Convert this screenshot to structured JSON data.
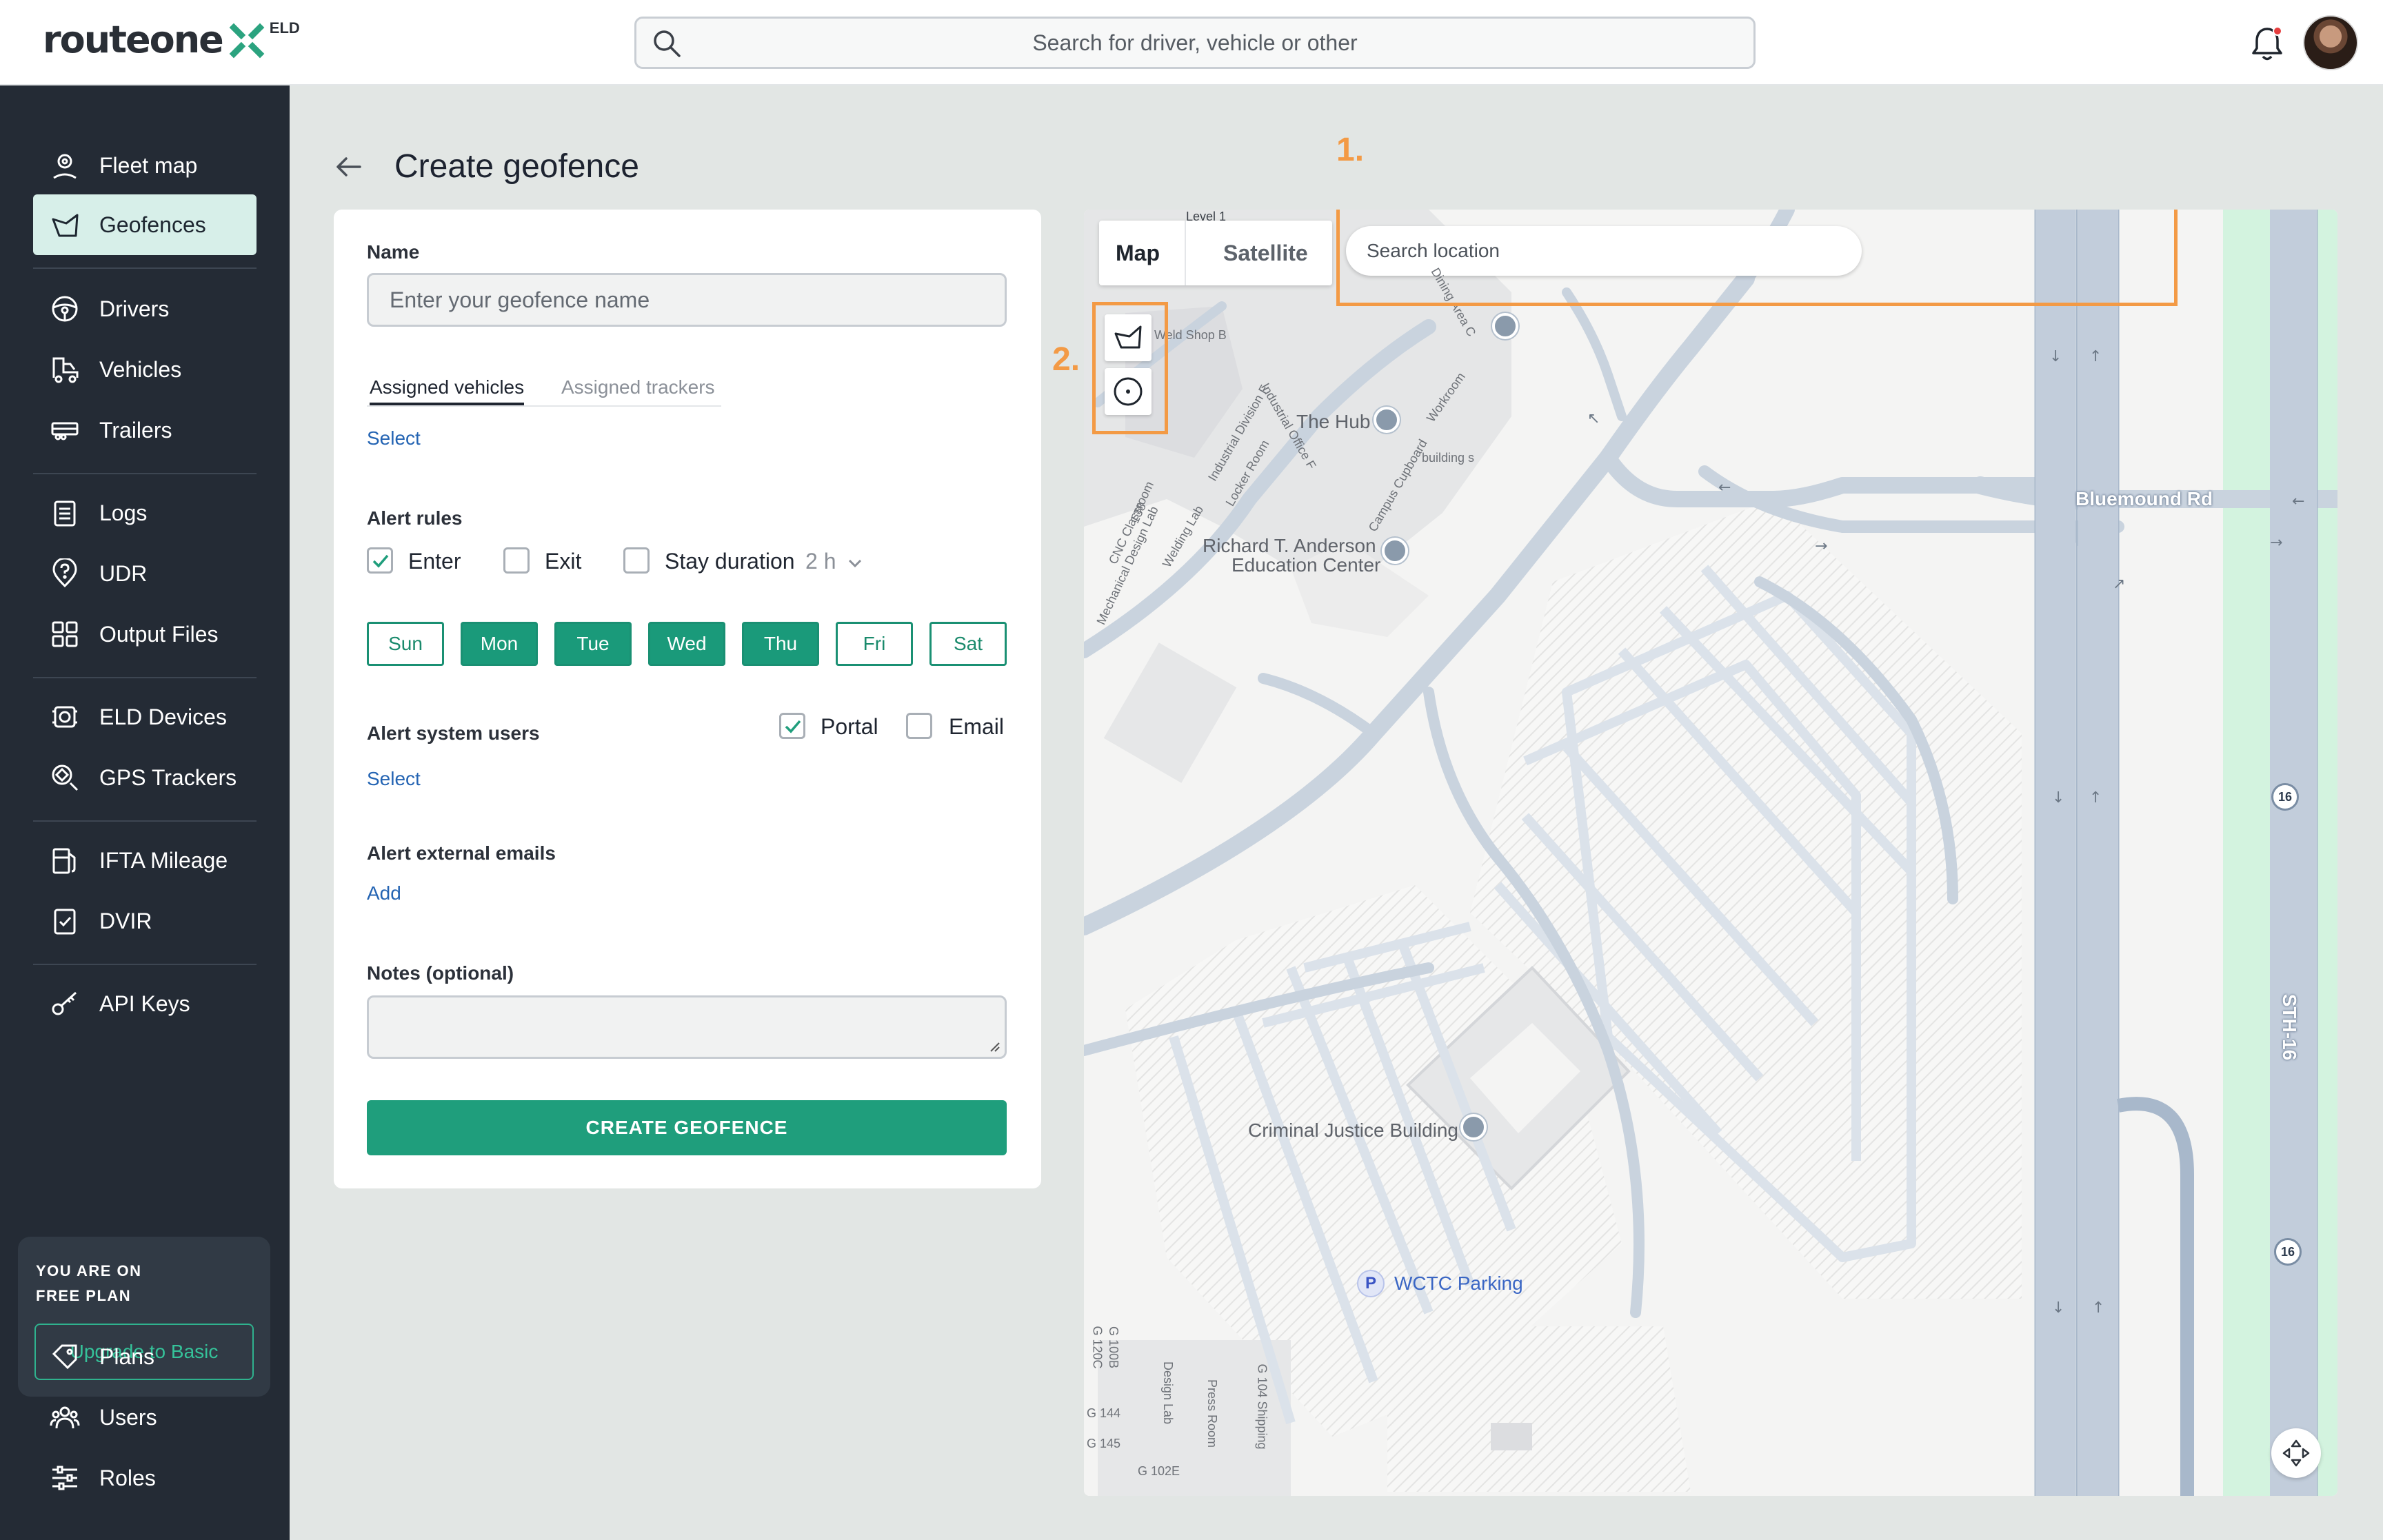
{
  "brand": {
    "name": "routeone",
    "suffix": "ELD",
    "accent": "#1f9e7c"
  },
  "topbar": {
    "search_placeholder": "Search for driver, vehicle or other",
    "icons": [
      "search-icon",
      "bell-icon",
      "avatar"
    ]
  },
  "sidebar": {
    "items": [
      {
        "label": "Fleet map",
        "icon": "map-pin-icon",
        "active": false
      },
      {
        "label": "Geofences",
        "icon": "geofence-icon",
        "active": true
      },
      {
        "label": "Drivers",
        "icon": "steering-wheel-icon",
        "active": false
      },
      {
        "label": "Vehicles",
        "icon": "truck-icon",
        "active": false
      },
      {
        "label": "Trailers",
        "icon": "trailer-icon",
        "active": false
      },
      {
        "label": "Logs",
        "icon": "clipboard-icon",
        "active": false
      },
      {
        "label": "UDR",
        "icon": "question-pin-icon",
        "active": false
      },
      {
        "label": "Output Files",
        "icon": "files-icon",
        "active": false
      },
      {
        "label": "ELD Devices",
        "icon": "device-icon",
        "active": false
      },
      {
        "label": "GPS Trackers",
        "icon": "gps-icon",
        "active": false
      },
      {
        "label": "IFTA Mileage",
        "icon": "fuel-icon",
        "active": false
      },
      {
        "label": "DVIR",
        "icon": "checklist-icon",
        "active": false
      },
      {
        "label": "API Keys",
        "icon": "key-icon",
        "active": false
      },
      {
        "label": "Plans",
        "icon": "tag-icon",
        "active": false
      },
      {
        "label": "Users",
        "icon": "users-icon",
        "active": false
      },
      {
        "label": "Roles",
        "icon": "sliders-icon",
        "active": false
      }
    ],
    "plan": {
      "line1": "YOU ARE ON",
      "line2": "FREE PLAN",
      "upgrade_label": "Upgrade to Basic"
    }
  },
  "page": {
    "title": "Create geofence"
  },
  "form": {
    "name_label": "Name",
    "name_placeholder": "Enter your geofence name",
    "tabs": [
      {
        "label": "Assigned vehicles",
        "active": true
      },
      {
        "label": "Assigned trackers",
        "active": false
      }
    ],
    "select_label": "Select",
    "alert_rules_label": "Alert rules",
    "rules": [
      {
        "label": "Enter",
        "checked": true
      },
      {
        "label": "Exit",
        "checked": false
      },
      {
        "label": "Stay duration",
        "checked": false
      }
    ],
    "stay_duration_value": "2 h",
    "days": [
      {
        "label": "Sun",
        "on": false
      },
      {
        "label": "Mon",
        "on": true
      },
      {
        "label": "Tue",
        "on": true
      },
      {
        "label": "Wed",
        "on": true
      },
      {
        "label": "Thu",
        "on": true
      },
      {
        "label": "Fri",
        "on": false
      },
      {
        "label": "Sat",
        "on": false
      }
    ],
    "alert_users_label": "Alert system users",
    "alert_users_select": "Select",
    "channels": [
      {
        "label": "Portal",
        "checked": true
      },
      {
        "label": "Email",
        "checked": false
      }
    ],
    "external_emails_label": "Alert external emails",
    "add_label": "Add",
    "notes_label": "Notes (optional)",
    "submit_label": "CREATE GEOFENCE"
  },
  "map": {
    "tabs": [
      {
        "label": "Map",
        "active": true
      },
      {
        "label": "Satellite",
        "active": false
      }
    ],
    "search_placeholder": "Search location",
    "annotations": [
      "1.",
      "2."
    ],
    "tools": [
      "polygon-draw-icon",
      "circle-draw-icon"
    ],
    "labels": {
      "level": "Level 1",
      "hub": "The Hub",
      "anderson1": "Richard T. Anderson",
      "anderson2": "Education Center",
      "cjb": "Criminal Justice Building",
      "parking": "WCTC Parking",
      "bluemound": "Bluemound Rd",
      "sth16": "STH-16",
      "hw16": "16",
      "weld": "Weld Shop B",
      "industrial_div": "Industrial Division F",
      "industrial_off": "Industrial Office F",
      "locker": "Locker Room",
      "campus": "Campus Cupboard",
      "workroom": "Workroom",
      "building_s": "building s",
      "dining": "Dining Area C",
      "welding": "Welding Lab",
      "room138": "138",
      "cnc": "CNC Classroom",
      "mech": "Mechanical Design Lab",
      "g100b": "G 100B",
      "g120c": "G 120C",
      "g144": "G 144",
      "g145": "G 145",
      "g102e": "G 102E",
      "design": "Design Lab",
      "press": "Press Room",
      "g104": "G 104 Shipping"
    },
    "colors": {
      "road": "#c9d3de",
      "highway": "#a8b8cb",
      "green": "#d3f3df",
      "highlight": "#f39a45"
    }
  }
}
